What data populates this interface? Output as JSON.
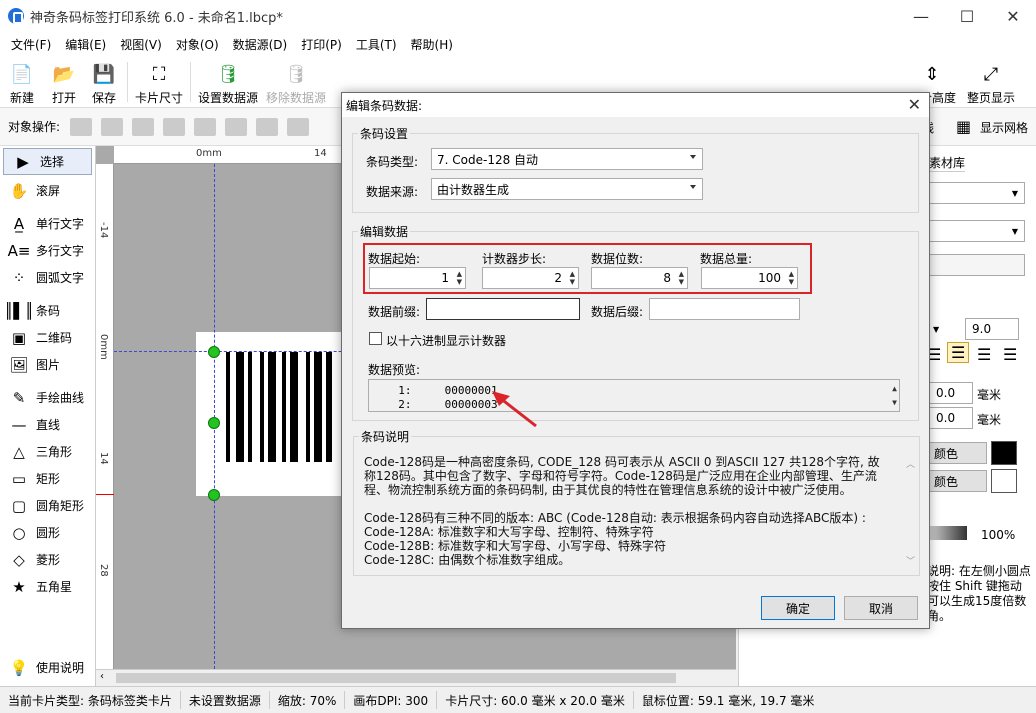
{
  "window": {
    "title": "神奇条码标签打印系统 6.0 - 未命名1.lbcp*",
    "min": "—",
    "max": "☐",
    "close": "✕"
  },
  "menu": [
    "文件(F)",
    "编辑(E)",
    "视图(V)",
    "对象(O)",
    "数据源(D)",
    "打印(P)",
    "工具(T)",
    "帮助(H)"
  ],
  "toolbar": {
    "new": "新建",
    "open": "打开",
    "save": "保存",
    "card_size": "卡片尺寸",
    "set_datasource": "设置数据源",
    "remove_datasource": "移除数据源",
    "fit_height": "适合高度",
    "whole_page": "整页显示"
  },
  "objops": {
    "label": "对象操作:",
    "guideline": "参考线",
    "show_grid": "显示网格"
  },
  "tools": {
    "select": "选择",
    "scroll": "滚屏",
    "single_text": "单行文字",
    "multi_text": "多行文字",
    "arc_text": "圆弧文字",
    "barcode": "条码",
    "qrcode": "二维码",
    "image": "图片",
    "freehand": "手绘曲线",
    "line": "直线",
    "triangle": "三角形",
    "rect": "矩形",
    "round_rect": "圆角矩形",
    "circle": "圆形",
    "diamond": "菱形",
    "star": "五角星",
    "help": "使用说明"
  },
  "ruler": {
    "top_zero": "0mm",
    "top_14": "14",
    "left_m14": "-14",
    "left_zero": "0mm",
    "left_14": "14",
    "left_28": "28"
  },
  "rightpanel": {
    "tab_material": "素材库",
    "font_size": "9.0",
    "offset_x": "0.0",
    "offset_y": "0.0",
    "unit_mm": "毫米",
    "color_label": "颜色",
    "opacity": "100%",
    "tip": "说明: 在左侧小圆点按住 Shift 键拖动可以生成15度倍数角。"
  },
  "status": {
    "card_type": "当前卡片类型: 条码标签类卡片",
    "datasource": "未设置数据源",
    "zoom": "缩放: 70%",
    "dpi": "画布DPI: 300",
    "card_size": "卡片尺寸: 60.0 毫米 x 20.0 毫米",
    "mouse_pos": "鼠标位置: 59.1 毫米, 19.7 毫米"
  },
  "dialog": {
    "title": "编辑条码数据:",
    "close": "✕",
    "group_barcode_settings": "条码设置",
    "barcode_type_label": "条码类型:",
    "barcode_type_value": "7. Code-128 自动",
    "datasource_label": "数据来源:",
    "datasource_value": "由计数器生成",
    "group_edit_data": "编辑数据",
    "start_label": "数据起始:",
    "start_value": "1",
    "step_label": "计数器步长:",
    "step_value": "2",
    "digits_label": "数据位数:",
    "digits_value": "8",
    "total_label": "数据总量:",
    "total_value": "100",
    "prefix_label": "数据前缀:",
    "suffix_label": "数据后缀:",
    "hex_label": "以十六进制显示计数器",
    "preview_label": "数据预览:",
    "preview_lines": [
      "  1:     00000001",
      "  2:     00000003"
    ],
    "group_desc": "条码说明",
    "desc_lines": [
      "Code-128码是一种高密度条码, CODE_128 码可表示从 ASCII 0 到ASCII 127 共128个字符, 故称128码。其中包含了数字、字母和符号字符。Code-128码是广泛应用在企业内部管理、生产流程、物流控制系统方面的条码码制, 由于其优良的特性在管理信息系统的设计中被广泛使用。",
      "",
      "Code-128码有三种不同的版本: ABC (Code-128自动: 表示根据条码内容自动选择ABC版本) :",
      "Code-128A: 标准数字和大写字母、控制符、特殊字符",
      "Code-128B: 标准数字和大写字母、小写字母、特殊字符",
      "Code-128C: 由偶数个标准数字组成。"
    ],
    "ok": "确定",
    "cancel": "取消"
  },
  "colors": {
    "highlight_red": "#d9252a",
    "guide_blue": "#3d48d6",
    "handle_green": "#22c322"
  }
}
